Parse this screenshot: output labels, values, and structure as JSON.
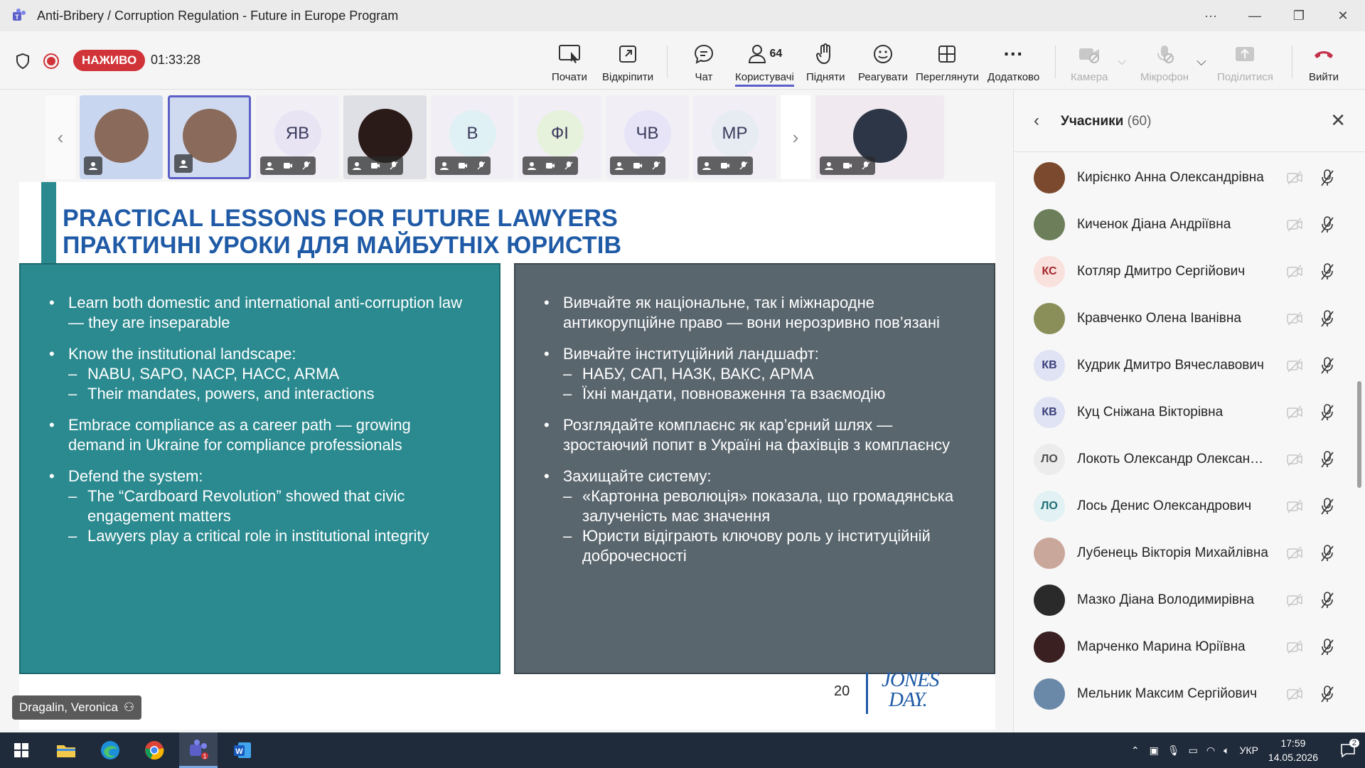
{
  "window": {
    "title": "Anti-Bribery / Corruption Regulation - Future in Europe Program",
    "more": "···",
    "minimize": "—",
    "restore": "❐",
    "close": "✕"
  },
  "meeting": {
    "live_label": "НАЖИВО",
    "timer": "01:33:28",
    "buttons": {
      "start": "Почати",
      "unpin": "Відкріпити",
      "chat": "Чат",
      "people": "Користувачі",
      "people_count": "64",
      "raise": "Підняти",
      "react": "Реагувати",
      "view": "Переглянути",
      "more": "Додатково",
      "camera": "Камера",
      "mic": "Мікрофон",
      "share": "Поділитися",
      "leave": "Вийти"
    }
  },
  "thumbnails": [
    {
      "type": "photo"
    },
    {
      "type": "photo",
      "selected": true
    },
    {
      "type": "initials",
      "initials": "ЯВ",
      "color": "#e8e4f4"
    },
    {
      "type": "photo"
    },
    {
      "type": "initials",
      "initials": "В",
      "color": "#dff1f4"
    },
    {
      "type": "initials",
      "initials": "ФІ",
      "color": "#e6f2dc"
    },
    {
      "type": "initials",
      "initials": "ЧВ",
      "color": "#e6e4f6"
    },
    {
      "type": "initials",
      "initials": "МР",
      "color": "#e7ecf3"
    },
    {
      "type": "photo"
    }
  ],
  "slide": {
    "title_en": "PRACTICAL LESSONS FOR FUTURE LAWYERS",
    "title_uk": "ПРАКТИЧНІ УРОКИ ДЛЯ МАЙБУТНІХ ЮРИСТІВ",
    "left": {
      "b1": "Learn both domestic and international anti-corruption law — they are inseparable",
      "b2": "Know the institutional landscape:",
      "b2s1": "NABU, SAPO, NACP, HACC, ARMA",
      "b2s2": "Their mandates, powers, and interactions",
      "b3": "Embrace compliance as a career path — growing demand in Ukraine for compliance professionals",
      "b4": "Defend the system:",
      "b4s1": "The “Cardboard Revolution” showed that civic engagement matters",
      "b4s2": "Lawyers play a critical role in institutional integrity"
    },
    "right": {
      "b1": "Вивчайте як національне, так і міжнародне антикорупційне право — вони нерозривно пов’язані",
      "b2": "Вивчайте інституційний ландшафт:",
      "b2s1": "НАБУ, САП, НАЗК, ВАКС, АРМА",
      "b2s2": "Їхні мандати, повноваження та взаємодію",
      "b3": "Розглядайте комплаєнс як кар’єрний шлях — зростаючий попит в Україні на фахівців з комплаєнсу",
      "b4": "Захищайте систему:",
      "b4s1": "«Картонна революція» показала, що громадянська залученість має значення",
      "b4s2": "Юристи відіграють ключову роль у інституційній доброчесності"
    },
    "page_number": "20",
    "logo_line1": "JONES",
    "logo_line2": "DAY."
  },
  "presenter": {
    "name": "Dragalin, Veronica"
  },
  "participants_panel": {
    "title": "Учасники",
    "count": "(60)",
    "people": [
      {
        "name": "Кирієнко Анна Олександрівна",
        "initials": "",
        "photo": true,
        "color": "#7b4a2e"
      },
      {
        "name": "Киченок Діана Андріївна",
        "initials": "",
        "photo": true,
        "color": "#6d7f5a"
      },
      {
        "name": "Котляр Дмитро Сергійович",
        "initials": "КС",
        "photo": false,
        "color": "#f9e1dd",
        "fg": "#a4262c"
      },
      {
        "name": "Кравченко Олена Іванівна",
        "initials": "",
        "photo": true,
        "color": "#8a8f5a"
      },
      {
        "name": "Кудрик Дмитро Вячеславович",
        "initials": "КВ",
        "photo": false,
        "color": "#dfe3f3",
        "fg": "#3b3f7a"
      },
      {
        "name": "Куц Сніжана Вікторівна",
        "initials": "КВ",
        "photo": false,
        "color": "#dfe3f3",
        "fg": "#3b3f7a"
      },
      {
        "name": "Локоть Олександр Олександ...",
        "initials": "ЛО",
        "photo": false,
        "color": "#ececec",
        "fg": "#505050"
      },
      {
        "name": "Лось Денис Олександрович",
        "initials": "ЛО",
        "photo": false,
        "color": "#e2f1f3",
        "fg": "#1f6f77"
      },
      {
        "name": "Лубенець Вікторія Михайлівна",
        "initials": "",
        "photo": true,
        "color": "#c9a79a"
      },
      {
        "name": "Мазко Діана Володимирівна",
        "initials": "",
        "photo": true,
        "color": "#2a2a2a"
      },
      {
        "name": "Марченко Марина Юріївна",
        "initials": "",
        "photo": true,
        "color": "#3a2020"
      },
      {
        "name": "Мельник Максим Сергійович",
        "initials": "",
        "photo": true,
        "color": "#6a89a8"
      }
    ]
  },
  "taskbar": {
    "lang": "УКР",
    "time": "17:59",
    "date": "14.05.2026",
    "notifications": "2",
    "teams_badge": "1"
  },
  "colors": {
    "accent": "#5b5fc7",
    "live": "#d13438",
    "slide_teal": "#2b8a8f",
    "slide_gray": "#5a666e",
    "title_blue": "#1f5aa6"
  }
}
